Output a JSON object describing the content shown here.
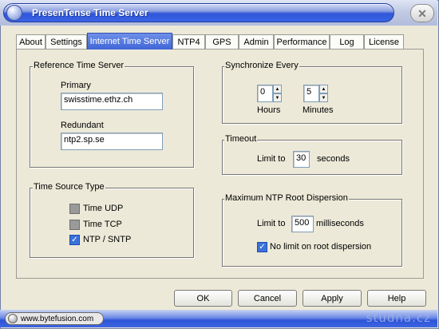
{
  "window": {
    "title": "PresenTense Time Server"
  },
  "tabs": [
    {
      "label": "About"
    },
    {
      "label": "Settings"
    },
    {
      "label": "Internet Time Server",
      "active": true
    },
    {
      "label": "NTP4"
    },
    {
      "label": "GPS"
    },
    {
      "label": "Admin"
    },
    {
      "label": "Performance"
    },
    {
      "label": "Log"
    },
    {
      "label": "License"
    }
  ],
  "reference": {
    "legend": "Reference Time Server",
    "primary_label": "Primary",
    "primary_value": "swisstime.ethz.ch",
    "redundant_label": "Redundant",
    "redundant_value": "ntp2.sp.se"
  },
  "source": {
    "legend": "Time Source Type",
    "options": [
      {
        "label": "Time UDP",
        "checked": false
      },
      {
        "label": "Time TCP",
        "checked": false
      },
      {
        "label": "NTP / SNTP",
        "checked": true
      }
    ]
  },
  "sync": {
    "legend": "Synchronize Every",
    "hours_value": "0",
    "hours_label": "Hours",
    "minutes_value": "5",
    "minutes_label": "Minutes"
  },
  "timeout": {
    "legend": "Timeout",
    "prefix": "Limit to",
    "value": "30",
    "unit": "seconds"
  },
  "dispersion": {
    "legend": "Maximum NTP Root Dispersion",
    "prefix": "Limit to",
    "value": "500",
    "unit": "milliseconds",
    "no_limit_label": "No limit on root dispersion",
    "no_limit_checked": true
  },
  "buttons": {
    "ok": "OK",
    "cancel": "Cancel",
    "apply": "Apply",
    "help": "Help"
  },
  "status": {
    "site": "www.bytefusion.com",
    "watermark": "studna.cz"
  },
  "icons": {
    "close": "close-icon",
    "checkmark": "checkmark-icon"
  },
  "colors": {
    "title_blue": "#2f56d8",
    "active_tab": "#3f66d8",
    "check_blue": "#3b72d9",
    "panel": "#ece9d8"
  }
}
